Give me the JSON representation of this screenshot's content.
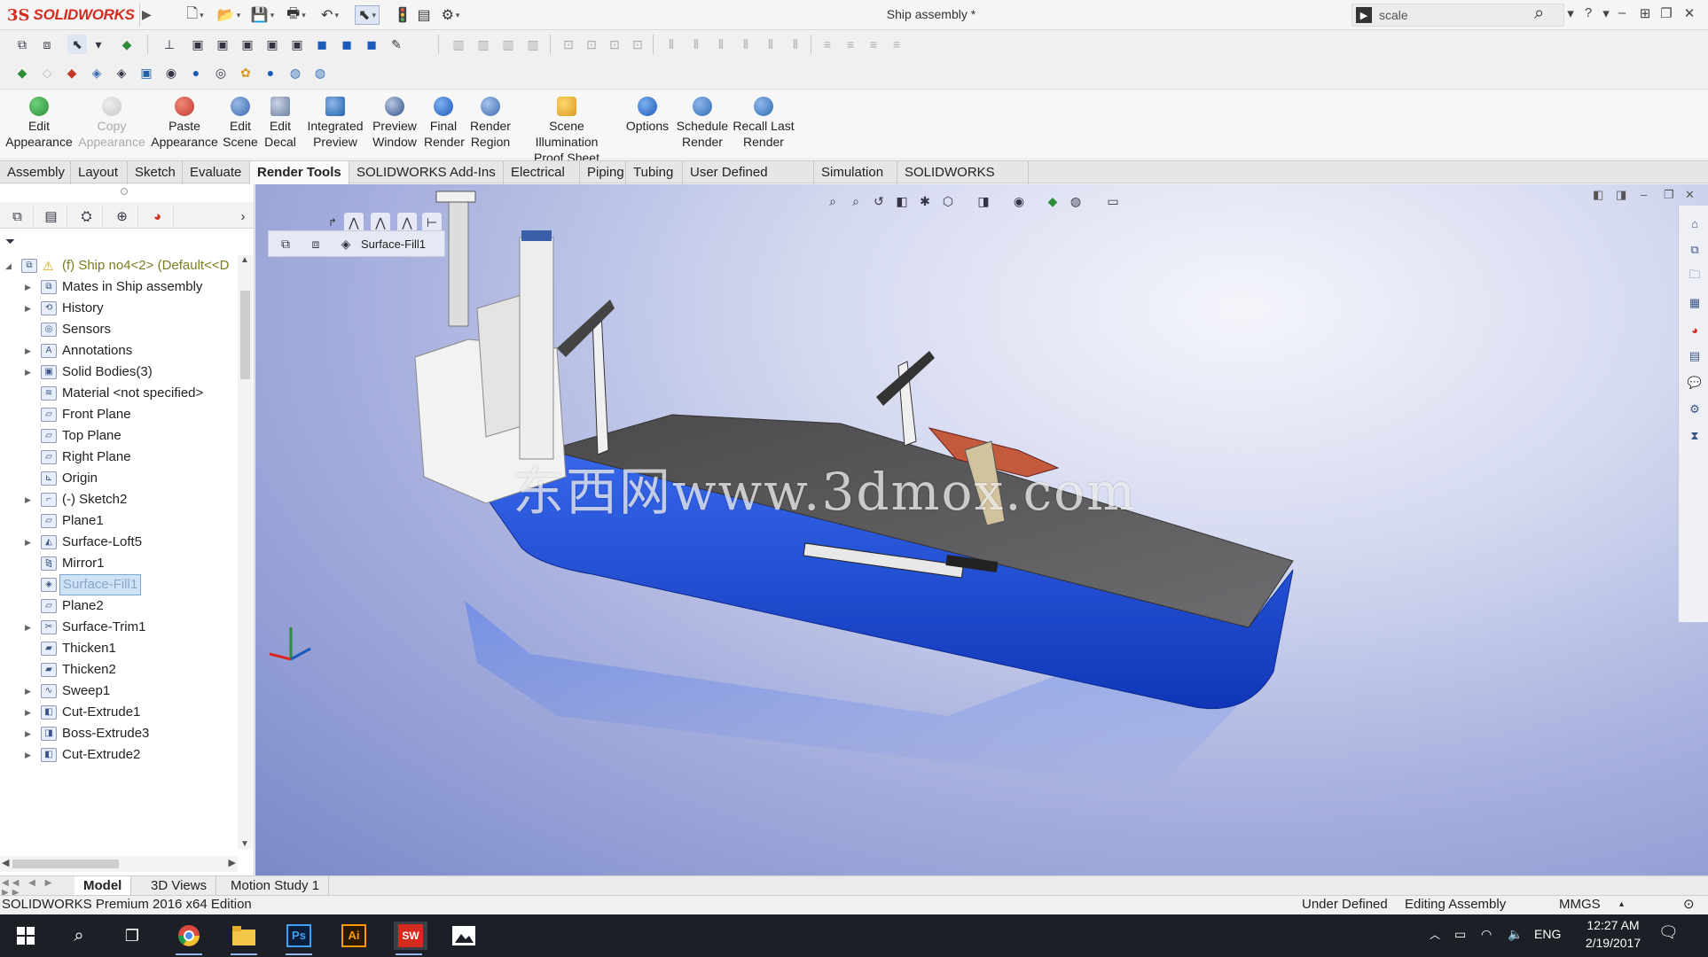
{
  "app": {
    "brand_ds": "3S",
    "brand_name": "SOLIDWORKS",
    "document_title": "Ship assembly *",
    "search_placeholder": "scale"
  },
  "ribbon": [
    {
      "id": "edit-appearance",
      "line1": "Edit",
      "line2": "Appearance",
      "enabled": true,
      "color": "#2e8b3a"
    },
    {
      "id": "copy-appearance",
      "line1": "Copy",
      "line2": "Appearance",
      "enabled": false,
      "color": "#c7c7c7"
    },
    {
      "id": "paste-appearance",
      "line1": "Paste",
      "line2": "Appearance",
      "enabled": true,
      "color": "#c0392b"
    },
    {
      "id": "edit-scene",
      "line1": "Edit",
      "line2": "Scene",
      "enabled": true,
      "color": "#3a6ab0"
    },
    {
      "id": "edit-decal",
      "line1": "Edit",
      "line2": "Decal",
      "enabled": true,
      "color": "#6b7f9e"
    },
    {
      "id": "integrated-preview",
      "line1": "Integrated",
      "line2": "Preview",
      "enabled": true,
      "color": "#1f5fa8"
    },
    {
      "id": "preview-window",
      "line1": "Preview",
      "line2": "Window",
      "enabled": true,
      "color": "#2d4e8a"
    },
    {
      "id": "final-render",
      "line1": "Final",
      "line2": "Render",
      "enabled": true,
      "color": "#1a5ab8"
    },
    {
      "id": "render-region",
      "line1": "Render",
      "line2": "Region",
      "enabled": true,
      "color": "#3a6ab0"
    },
    {
      "id": "scene-illumination",
      "line1": "Scene Illumination",
      "line2": "Proof Sheet",
      "enabled": true,
      "color": "#d99a1e"
    },
    {
      "id": "options",
      "line1": "Options",
      "line2": "",
      "enabled": true,
      "color": "#1a5ab8"
    },
    {
      "id": "schedule-render",
      "line1": "Schedule",
      "line2": "Render",
      "enabled": true,
      "color": "#2c6bb5"
    },
    {
      "id": "recall-last-render",
      "line1": "Recall Last",
      "line2": "Render",
      "enabled": true,
      "color": "#2c6bb5"
    }
  ],
  "tabs": [
    {
      "label": "Assembly",
      "active": false
    },
    {
      "label": "Layout",
      "active": false
    },
    {
      "label": "Sketch",
      "active": false
    },
    {
      "label": "Evaluate",
      "active": false
    },
    {
      "label": "Render Tools",
      "active": true
    },
    {
      "label": "SOLIDWORKS Add-Ins",
      "active": false
    },
    {
      "label": "Electrical",
      "active": false
    },
    {
      "label": "Piping",
      "active": false
    },
    {
      "label": "Tubing",
      "active": false
    },
    {
      "label": "User Defined Route",
      "active": false
    },
    {
      "label": "Simulation",
      "active": false
    },
    {
      "label": "SOLIDWORKS MBD",
      "active": false
    }
  ],
  "tree": {
    "root": "(f) Ship no4<2> (Default<<D",
    "items": [
      {
        "label": "Mates in Ship assembly",
        "expandable": true,
        "icon": "mates-icon",
        "selected": false
      },
      {
        "label": "History",
        "expandable": true,
        "icon": "history-icon",
        "selected": false
      },
      {
        "label": "Sensors",
        "expandable": false,
        "icon": "sensors-icon",
        "selected": false
      },
      {
        "label": "Annotations",
        "expandable": true,
        "icon": "annotations-icon",
        "selected": false
      },
      {
        "label": "Solid Bodies(3)",
        "expandable": true,
        "icon": "solid-bodies-icon",
        "selected": false
      },
      {
        "label": "Material <not specified>",
        "expandable": false,
        "icon": "material-icon",
        "selected": false
      },
      {
        "label": "Front Plane",
        "expandable": false,
        "icon": "plane-icon",
        "selected": false
      },
      {
        "label": "Top Plane",
        "expandable": false,
        "icon": "plane-icon",
        "selected": false
      },
      {
        "label": "Right Plane",
        "expandable": false,
        "icon": "plane-icon",
        "selected": false
      },
      {
        "label": "Origin",
        "expandable": false,
        "icon": "origin-icon",
        "selected": false
      },
      {
        "label": "(-) Sketch2",
        "expandable": true,
        "icon": "sketch-icon",
        "selected": false
      },
      {
        "label": "Plane1",
        "expandable": false,
        "icon": "plane-icon",
        "selected": false
      },
      {
        "label": "Surface-Loft5",
        "expandable": true,
        "icon": "surface-loft-icon",
        "selected": false
      },
      {
        "label": "Mirror1",
        "expandable": false,
        "icon": "mirror-icon",
        "selected": false
      },
      {
        "label": "Surface-Fill1",
        "expandable": false,
        "icon": "surface-fill-icon",
        "selected": true
      },
      {
        "label": "Plane2",
        "expandable": false,
        "icon": "plane-icon",
        "selected": false
      },
      {
        "label": "Surface-Trim1",
        "expandable": true,
        "icon": "surface-trim-icon",
        "selected": false
      },
      {
        "label": "Thicken1",
        "expandable": false,
        "icon": "thicken-icon",
        "selected": false
      },
      {
        "label": "Thicken2",
        "expandable": false,
        "icon": "thicken-icon",
        "selected": false
      },
      {
        "label": "Sweep1",
        "expandable": true,
        "icon": "sweep-icon",
        "selected": false
      },
      {
        "label": "Cut-Extrude1",
        "expandable": true,
        "icon": "cut-extrude-icon",
        "selected": false
      },
      {
        "label": "Boss-Extrude3",
        "expandable": true,
        "icon": "boss-extrude-icon",
        "selected": false
      },
      {
        "label": "Cut-Extrude2",
        "expandable": true,
        "icon": "cut-extrude-icon",
        "selected": false
      }
    ]
  },
  "viewport": {
    "breadcrumb_label": "Surface-Fill1",
    "watermark": "东西网www.3dmox.com"
  },
  "bottom_tabs": [
    {
      "label": "Model",
      "active": true
    },
    {
      "label": "3D Views",
      "active": false
    },
    {
      "label": "Motion Study 1",
      "active": false
    }
  ],
  "status": {
    "edition": "SOLIDWORKS Premium 2016 x64 Edition",
    "definition": "Under Defined",
    "mode": "Editing Assembly",
    "units": "MMGS"
  },
  "taskbar": {
    "lang": "ENG",
    "time": "12:27 AM",
    "date": "2/19/2017"
  },
  "colors": {
    "brand_red": "#d52b1e",
    "hull_blue": "#1747d4",
    "selection_blue": "#cfe3f7"
  }
}
